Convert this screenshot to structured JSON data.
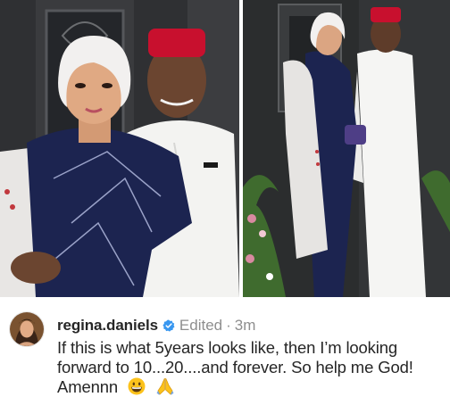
{
  "post": {
    "username": "regina.daniels",
    "edited": "Edited",
    "separator": "·",
    "time": "3m",
    "caption_lines": [
      "If this is what 5years looks like, then I’m looking",
      "forward to 10...20....and forever. So help me God!",
      "Amennn"
    ],
    "emojis": [
      "grinning-face-emoji",
      "folded-hands-emoji"
    ]
  },
  "colors": {
    "text": "#262626",
    "muted": "#8e8e8e",
    "verified_blue": "#3897f0"
  }
}
